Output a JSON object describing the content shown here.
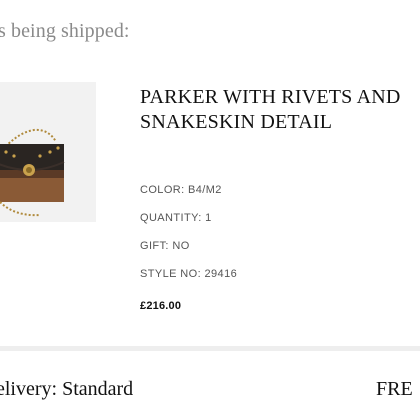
{
  "header": {
    "text": "s being shipped:"
  },
  "product": {
    "image_icon": "handbag-image",
    "name": "PARKER WITH RIVETS AND SNAKESKIN DETAIL",
    "color": "COLOR: B4/M2",
    "quantity": "QUANTITY: 1",
    "gift": "GIFT: NO",
    "style_no": "STYLE NO: 29416",
    "price": "£216.00"
  },
  "delivery": {
    "label": "elivery: Standard",
    "price": "FRE"
  },
  "colors": {
    "text_primary": "#111111",
    "text_secondary": "#555555",
    "header_gray": "#8a8a8a",
    "image_bg": "#f2f2f2",
    "divider": "#eeeeee"
  }
}
